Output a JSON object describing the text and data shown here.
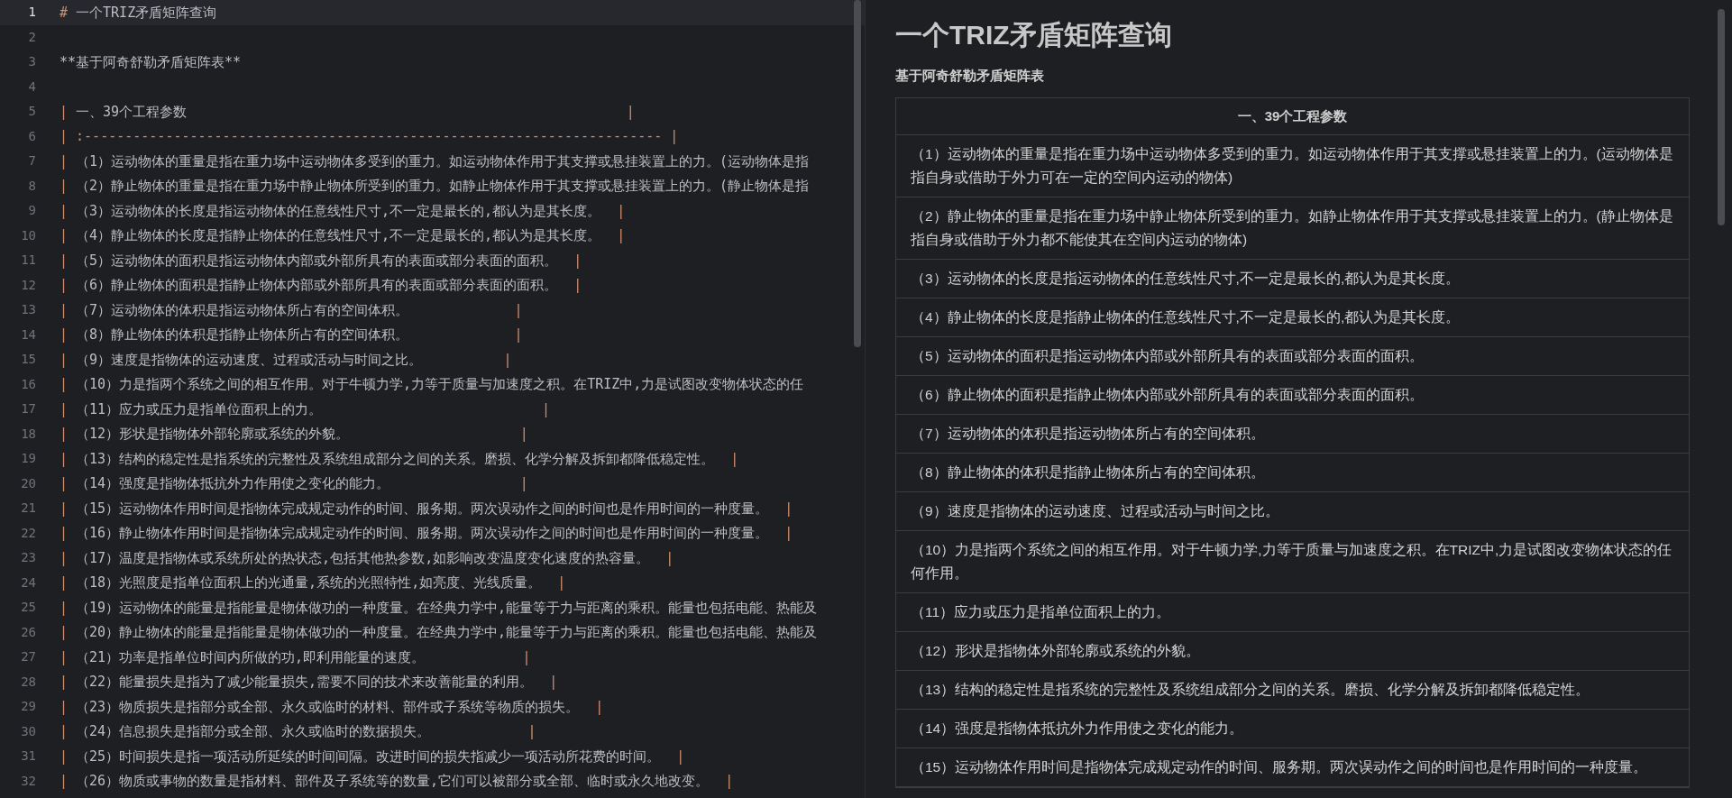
{
  "editor": {
    "lines": [
      {
        "number": "1",
        "text": "# 一个TRIZ矛盾矩阵查询",
        "current": true
      },
      {
        "number": "2",
        "current": false
      },
      {
        "number": "3",
        "text": "**基于阿奇舒勒矛盾矩阵表**",
        "current": false
      },
      {
        "number": "4",
        "current": false
      },
      {
        "number": "5",
        "text": "| 一、39个工程参数",
        "end": "                                                      |",
        "current": false
      },
      {
        "number": "6",
        "text": "| :----------------------------------------------------------------------- |",
        "current": false
      },
      {
        "number": "7",
        "text": "| （1）运动物体的重量是指在重力场中运动物体多受到的重力。如运动物体作用于其支撑或悬挂装置上的力。(运动物体是指",
        "current": false
      },
      {
        "number": "8",
        "text": "| （2）静止物体的重量是指在重力场中静止物体所受到的重力。如静止物体作用于其支撑或悬挂装置上的力。(静止物体是指",
        "current": false
      },
      {
        "number": "9",
        "text": "| （3）运动物体的长度是指运动物体的任意线性尺寸,不一定是最长的,都认为是其长度。  |",
        "current": false
      },
      {
        "number": "10",
        "text": "| （4）静止物体的长度是指静止物体的任意线性尺寸,不一定是最长的,都认为是其长度。  |",
        "current": false
      },
      {
        "number": "11",
        "text": "| （5）运动物体的面积是指运动物体内部或外部所具有的表面或部分表面的面积。  |",
        "current": false
      },
      {
        "number": "12",
        "text": "| （6）静止物体的面积是指静止物体内部或外部所具有的表面或部分表面的面积。  |",
        "current": false
      },
      {
        "number": "13",
        "text": "| （7）运动物体的体积是指运动物体所占有的空间体积。",
        "end": "             |",
        "current": false
      },
      {
        "number": "14",
        "text": "| （8）静止物体的体积是指静止物体所占有的空间体积。",
        "end": "             |",
        "current": false
      },
      {
        "number": "15",
        "text": "| （9）速度是指物体的运动速度、过程或活动与时间之比。",
        "end": "          |",
        "current": false
      },
      {
        "number": "16",
        "text": "| （10）力是指两个系统之间的相互作用。对于牛顿力学,力等于质量与加速度之积。在TRIZ中,力是试图改变物体状态的任",
        "current": false
      },
      {
        "number": "17",
        "text": "| （11）应力或压力是指单位面积上的力。",
        "end": "                           |",
        "current": false
      },
      {
        "number": "18",
        "text": "| （12）形状是指物体外部轮廓或系统的外貌。",
        "end": "                     |",
        "current": false
      },
      {
        "number": "19",
        "text": "| （13）结构的稳定性是指系统的完整性及系统组成部分之间的关系。磨损、化学分解及拆卸都降低稳定性。  |",
        "current": false
      },
      {
        "number": "20",
        "text": "| （14）强度是指物体抵抗外力作用使之变化的能力。",
        "end": "                |",
        "current": false
      },
      {
        "number": "21",
        "text": "| （15）运动物体作用时间是指物体完成规定动作的时间、服务期。两次误动作之间的时间也是作用时间的一种度量。  |",
        "current": false
      },
      {
        "number": "22",
        "text": "| （16）静止物体作用时间是指物体完成规定动作的时间、服务期。两次误动作之间的时间也是作用时间的一种度量。  |",
        "current": false
      },
      {
        "number": "23",
        "text": "| （17）温度是指物体或系统所处的热状态,包括其他热参数,如影响改变温度变化速度的热容量。  |",
        "current": false
      },
      {
        "number": "24",
        "text": "| （18）光照度是指单位面积上的光通量,系统的光照特性,如亮度、光线质量。  |",
        "current": false
      },
      {
        "number": "25",
        "text": "| （19）运动物体的能量是指能量是物体做功的一种度量。在经典力学中,能量等于力与距离的乘积。能量也包括电能、热能及",
        "current": false
      },
      {
        "number": "26",
        "text": "| （20）静止物体的能量是指能量是物体做功的一种度量。在经典力学中,能量等于力与距离的乘积。能量也包括电能、热能及",
        "current": false
      },
      {
        "number": "27",
        "text": "| （21）功率是指单位时间内所做的功,即利用能量的速度。",
        "end": "            |",
        "current": false
      },
      {
        "number": "28",
        "text": "| （22）能量损失是指为了减少能量损失,需要不同的技术来改善能量的利用。  |",
        "current": false
      },
      {
        "number": "29",
        "text": "| （23）物质损失是指部分或全部、永久或临时的材料、部件或子系统等物质的损失。  |",
        "current": false
      },
      {
        "number": "30",
        "text": "| （24）信息损失是指部分或全部、永久或临时的数据损失。",
        "end": "            |",
        "current": false
      },
      {
        "number": "31",
        "text": "| （25）时间损失是指一项活动所延续的时间间隔。改进时间的损失指减少一项活动所花费的时间。  |",
        "current": false
      },
      {
        "number": "32",
        "text": "| （26）物质或事物的数量是指材料、部件及子系统等的数量,它们可以被部分或全部、临时或永久地改变。  |",
        "current": false
      }
    ]
  },
  "preview": {
    "title": "一个TRIZ矛盾矩阵查询",
    "subtitle": "基于阿奇舒勒矛盾矩阵表",
    "table": {
      "header": "一、39个工程参数",
      "rows": [
        "（1）运动物体的重量是指在重力场中运动物体多受到的重力。如运动物体作用于其支撑或悬挂装置上的力。(运动物体是指自身或借助于外力可在一定的空间内运动的物体)",
        "（2）静止物体的重量是指在重力场中静止物体所受到的重力。如静止物体作用于其支撑或悬挂装置上的力。(静止物体是指自身或借助于外力都不能使其在空间内运动的物体)",
        "（3）运动物体的长度是指运动物体的任意线性尺寸,不一定是最长的,都认为是其长度。",
        "（4）静止物体的长度是指静止物体的任意线性尺寸,不一定是最长的,都认为是其长度。",
        "（5）运动物体的面积是指运动物体内部或外部所具有的表面或部分表面的面积。",
        "（6）静止物体的面积是指静止物体内部或外部所具有的表面或部分表面的面积。",
        "（7）运动物体的体积是指运动物体所占有的空间体积。",
        "（8）静止物体的体积是指静止物体所占有的空间体积。",
        "（9）速度是指物体的运动速度、过程或活动与时间之比。",
        "（10）力是指两个系统之间的相互作用。对于牛顿力学,力等于质量与加速度之积。在TRIZ中,力是试图改变物体状态的任何作用。",
        "（11）应力或压力是指单位面积上的力。",
        "（12）形状是指物体外部轮廓或系统的外貌。",
        "（13）结构的稳定性是指系统的完整性及系统组成部分之间的关系。磨损、化学分解及拆卸都降低稳定性。",
        "（14）强度是指物体抵抗外力作用使之变化的能力。",
        "（15）运动物体作用时间是指物体完成规定动作的时间、服务期。两次误动作之间的时间也是作用时间的一种度量。"
      ]
    }
  }
}
